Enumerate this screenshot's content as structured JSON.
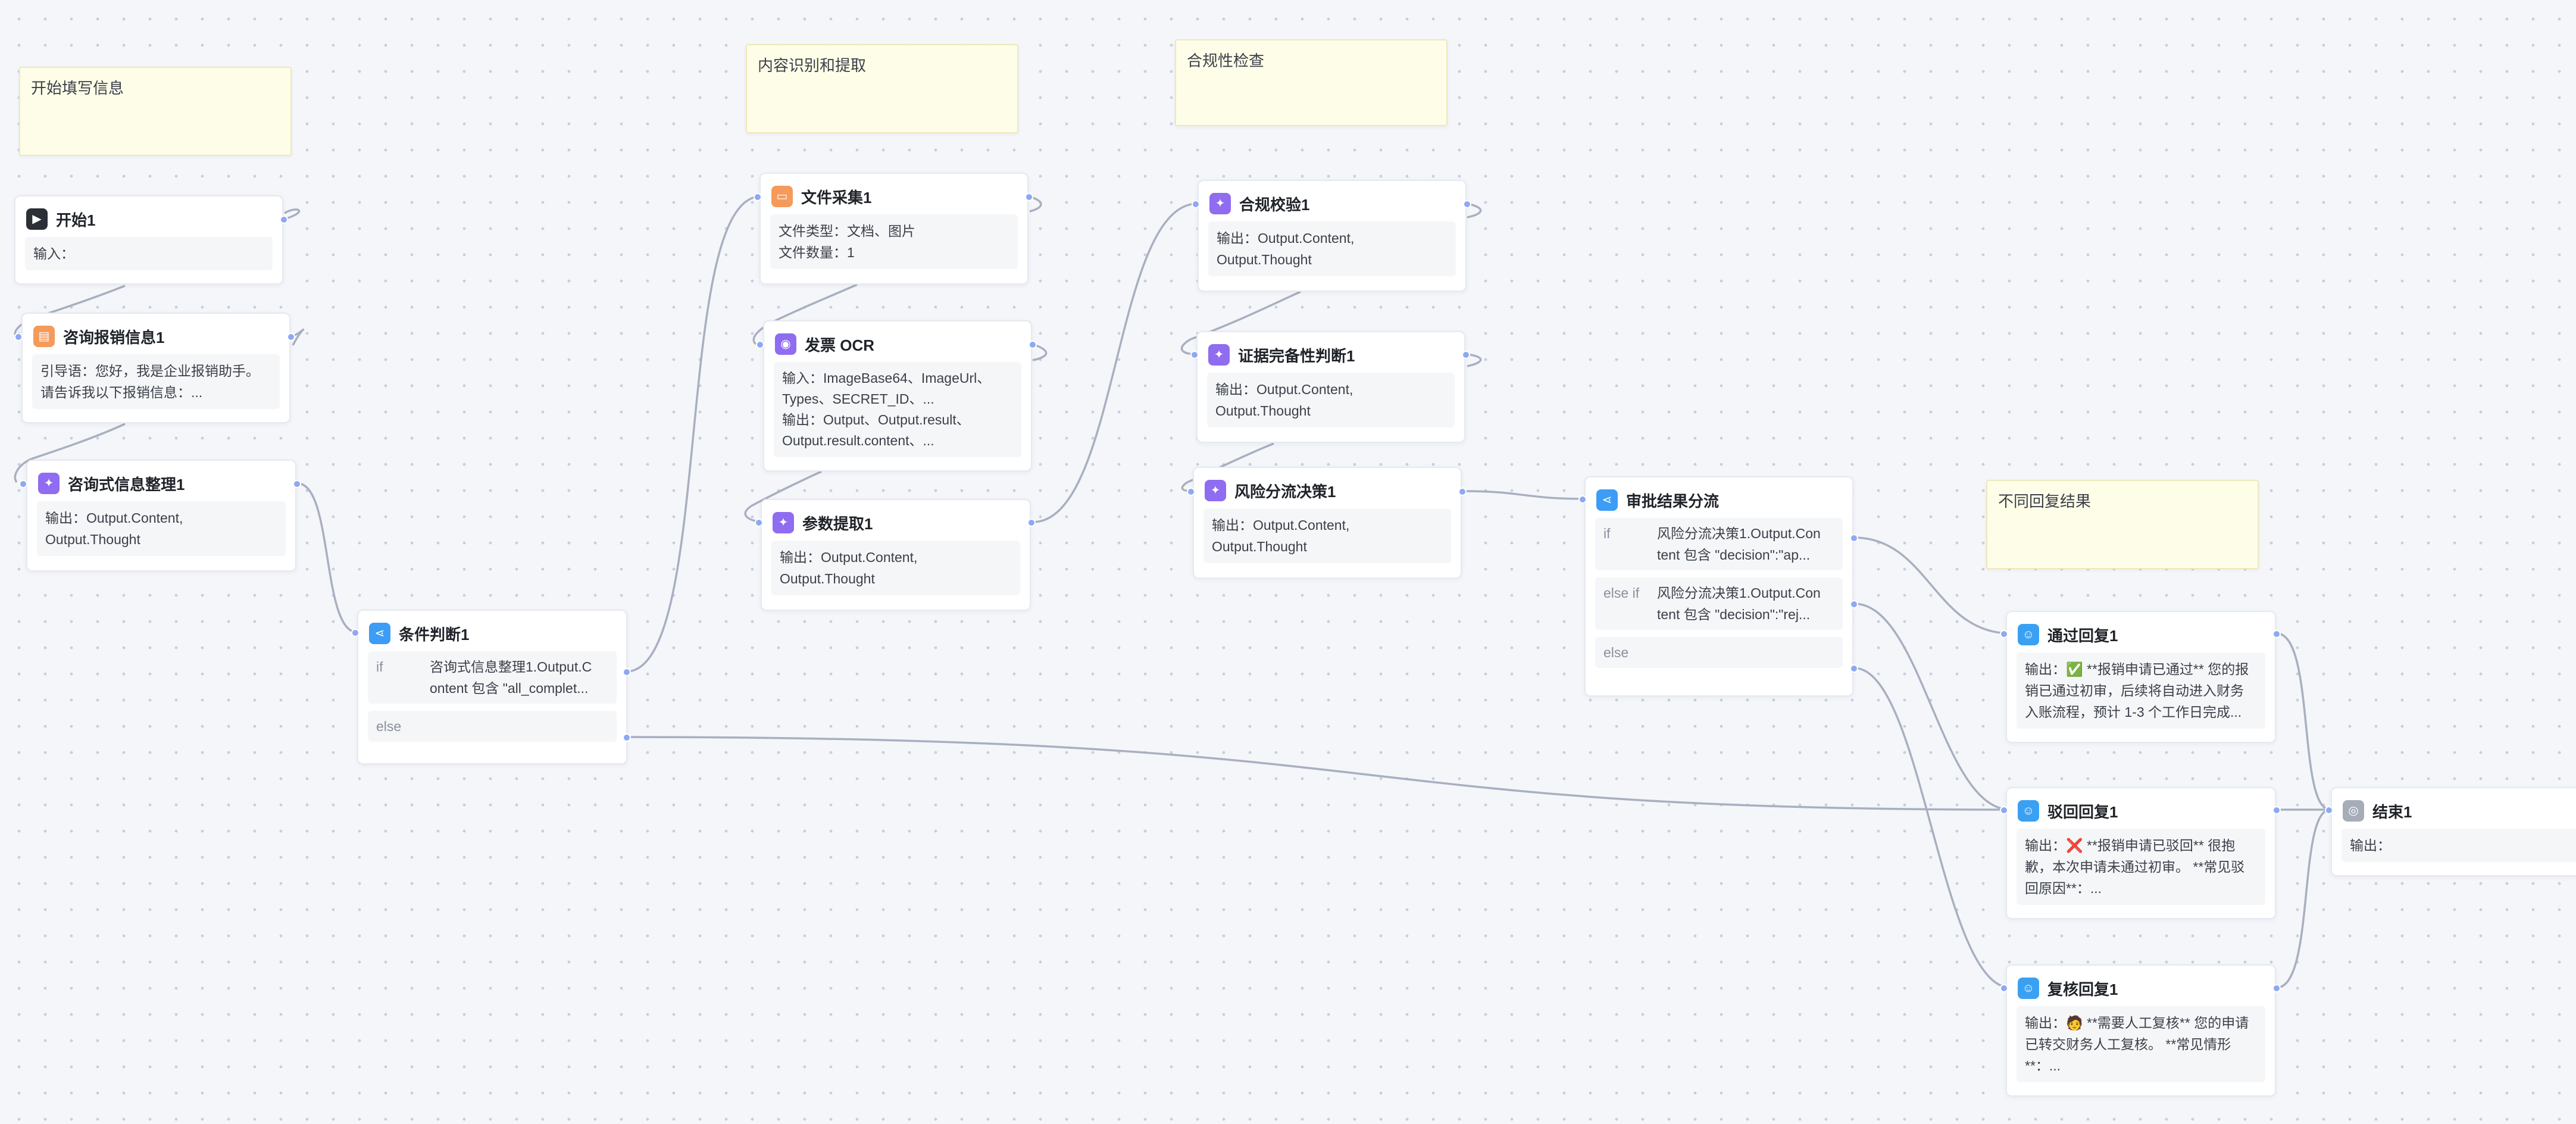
{
  "notes": {
    "start": "开始填写信息",
    "extract": "内容识别和提取",
    "compliance": "合规性检查",
    "reply": "不同回复结果"
  },
  "nodes": {
    "start": {
      "title": "开始1",
      "body": "输入："
    },
    "consult": {
      "title": "咨询报销信息1",
      "body": "引导语：您好，我是企业报销助手。\n请告诉我以下报销信息：..."
    },
    "organize": {
      "title": "咨询式信息整理1",
      "body": "输出：Output.Content,\nOutput.Thought"
    },
    "cond": {
      "title": "条件判断1",
      "if_kw": "if",
      "if_text": "咨询式信息整理1.Output.C\nontent 包含 \"all_complet...",
      "else_kw": "else"
    },
    "filecollect": {
      "title": "文件采集1",
      "body": "文件类型：文档、图片\n文件数量：1"
    },
    "ocr": {
      "title": "发票 OCR",
      "body": "输入：ImageBase64、ImageUrl、\nTypes、SECRET_ID、...\n输出：Output、Output.result、\nOutput.result.content、..."
    },
    "param": {
      "title": "参数提取1",
      "body": "输出：Output.Content,\nOutput.Thought"
    },
    "compcheck": {
      "title": "合规校验1",
      "body": "输出：Output.Content,\nOutput.Thought"
    },
    "evidence": {
      "title": "证据完备性判断1",
      "body": "输出：Output.Content,\nOutput.Thought"
    },
    "risk": {
      "title": "风险分流决策1",
      "body": "输出：Output.Content,\nOutput.Thought"
    },
    "approval": {
      "title": "审批结果分流",
      "if_kw": "if",
      "if_text": "风险分流决策1.Output.Con\ntent 包含 \"decision\":\"ap...",
      "elseif_kw": "else if",
      "elseif_text": "风险分流决策1.Output.Con\ntent 包含 \"decision\":\"rej...",
      "else_kw": "else"
    },
    "pass": {
      "title": "通过回复1",
      "body": "输出：✅ **报销申请已通过** 您的报\n销已通过初审，后续将自动进入财务\n入账流程，预计 1-3 个工作日完成..."
    },
    "reject": {
      "title": "驳回回复1",
      "body": "输出：❌ **报销申请已驳回** 很抱\n歉，本次申请未通过初审。 **常见驳\n回原因**：..."
    },
    "review": {
      "title": "复核回复1",
      "body": "输出：🧑 **需要人工复核** 您的申请\n已转交财务人工复核。 **常见情形\n**：..."
    },
    "end": {
      "title": "结束1",
      "body": "输出："
    }
  },
  "icons": {
    "start": "play-icon",
    "consult": "clipboard-icon",
    "llm": "sparkle-icon",
    "cond": "branch-icon",
    "folder": "folder-icon",
    "ocr": "plugin-icon",
    "reply": "chat-icon",
    "end": "stop-icon"
  },
  "colors": {
    "dark": "#2b2f36",
    "orange": "#f59a5b",
    "purple": "#8f6cf0",
    "blue": "#3d9cf5",
    "reply_blue": "#3aa0f2",
    "grey": "#a7adb8",
    "edge": "#a8afc0",
    "port": "#8ea8f4"
  }
}
